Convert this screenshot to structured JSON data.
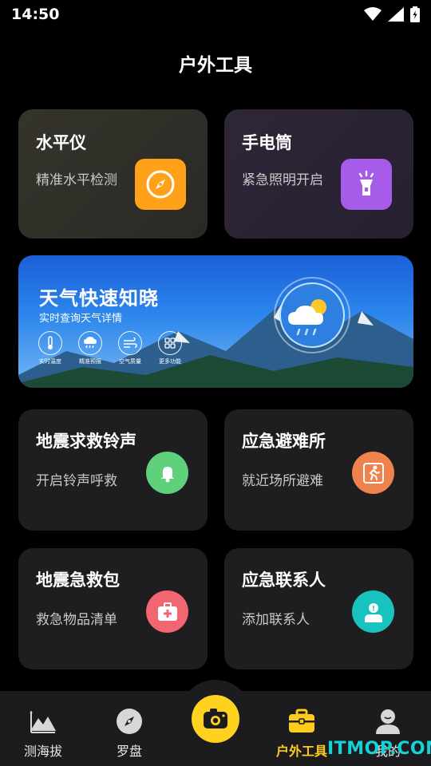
{
  "status_bar": {
    "time": "14:50"
  },
  "page_title": "户外工具",
  "tools_top": [
    {
      "title": "水平仪",
      "subtitle": "精准水平检测",
      "icon": "compass-icon",
      "color": "#ffa21a"
    },
    {
      "title": "手电筒",
      "subtitle": "紧急照明开启",
      "icon": "flashlight-icon",
      "color": "#a65ce8"
    }
  ],
  "banner": {
    "title": "天气快速知晓",
    "subtitle": "实时查询天气详情",
    "features": [
      {
        "label": "实时温度",
        "icon": "thermometer-icon"
      },
      {
        "label": "精准预报",
        "icon": "cloud-rain-icon"
      },
      {
        "label": "空气质量",
        "icon": "wind-icon"
      },
      {
        "label": "更多功能",
        "icon": "grid-icon"
      }
    ]
  },
  "tools": [
    {
      "title": "地震求救铃声",
      "subtitle": "开启铃声呼救",
      "icon": "bell-icon",
      "color": "#5fd17a"
    },
    {
      "title": "应急避难所",
      "subtitle": "就近场所避难",
      "icon": "running-person-icon",
      "color": "#f0824d"
    },
    {
      "title": "地震急救包",
      "subtitle": "救急物品清单",
      "icon": "first-aid-kit-icon",
      "color": "#f26672"
    },
    {
      "title": "应急联系人",
      "subtitle": "添加联系人",
      "icon": "contact-icon",
      "color": "#18c3bf"
    }
  ],
  "nav": {
    "items": [
      {
        "label": "测海拔",
        "icon": "mountain-icon"
      },
      {
        "label": "罗盘",
        "icon": "compass-needle-icon"
      },
      {
        "label": "",
        "icon": "camera-icon"
      },
      {
        "label": "户外工具",
        "icon": "toolbox-icon",
        "active": true
      },
      {
        "label": "我的",
        "icon": "user-icon"
      }
    ],
    "active_color": "#ffcc1e"
  },
  "watermark": "ITMOP.COM"
}
